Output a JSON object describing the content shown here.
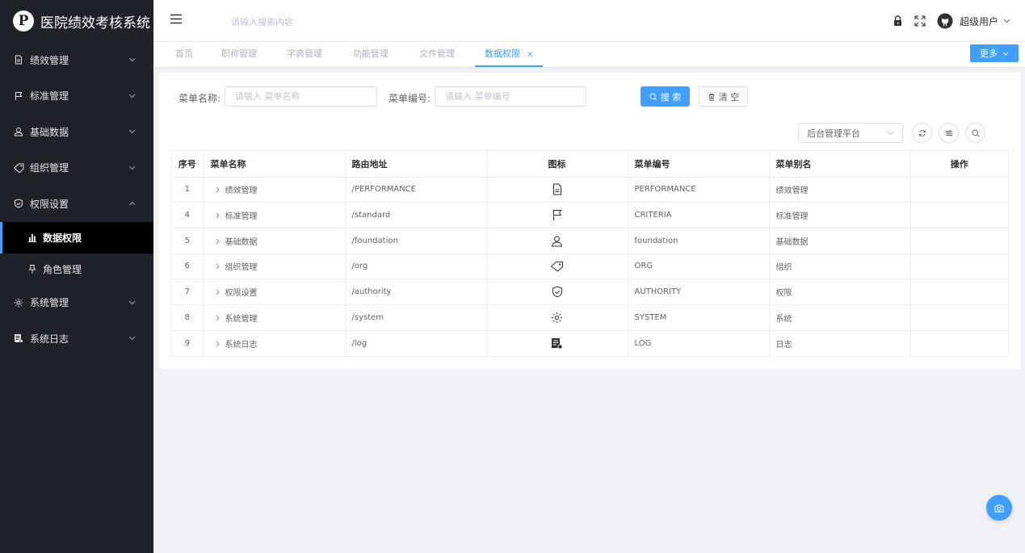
{
  "app": {
    "title": "医院绩效考核系统",
    "logo_letter": "P"
  },
  "sidebar": {
    "items": [
      {
        "label": "绩效管理",
        "icon": "document-icon",
        "expanded": false
      },
      {
        "label": "标准管理",
        "icon": "flag-icon",
        "expanded": false
      },
      {
        "label": "基础数据",
        "icon": "user-icon",
        "expanded": false
      },
      {
        "label": "组织管理",
        "icon": "tag-icon",
        "expanded": false
      },
      {
        "label": "权限设置",
        "icon": "shield-check-icon",
        "expanded": true,
        "children": [
          {
            "label": "数据权限",
            "icon": "bar-chart-icon",
            "active": true
          },
          {
            "label": "角色管理",
            "icon": "pin-icon",
            "active": false
          }
        ]
      },
      {
        "label": "系统管理",
        "icon": "gear-icon",
        "expanded": false
      },
      {
        "label": "系统日志",
        "icon": "log-icon",
        "expanded": false
      }
    ]
  },
  "header": {
    "search_placeholder": "请输入搜索内容",
    "username": "超级用户"
  },
  "tabs": {
    "items": [
      {
        "label": "首页",
        "active": false
      },
      {
        "label": "职称管理",
        "active": false
      },
      {
        "label": "字典管理",
        "active": false
      },
      {
        "label": "功能管理",
        "active": false
      },
      {
        "label": "文件管理",
        "active": false
      },
      {
        "label": "数据权限",
        "active": true,
        "close": "×"
      }
    ],
    "more_label": "更多"
  },
  "filters": {
    "menu_name_label": "菜单名称:",
    "menu_name_placeholder": "请输入 菜单名称",
    "menu_code_label": "菜单编号:",
    "menu_code_placeholder": "请输入 菜单编号",
    "search_label": "搜 索",
    "clear_label": "清 空",
    "platform_selected": "后台管理平台"
  },
  "table": {
    "columns": [
      "序号",
      "菜单名称",
      "路由地址",
      "图标",
      "菜单编号",
      "菜单别名",
      "操作"
    ],
    "rows": [
      {
        "index": "1",
        "name": "绩效管理",
        "route": "/PERFORMANCE",
        "icon": "document-icon",
        "code": "PERFORMANCE",
        "alias": "绩效管理",
        "action": ""
      },
      {
        "index": "4",
        "name": "标准管理",
        "route": "/standard",
        "icon": "flag-icon",
        "code": "CRITERIA",
        "alias": "标准管理",
        "action": ""
      },
      {
        "index": "5",
        "name": "基础数据",
        "route": "/foundation",
        "icon": "user-icon",
        "code": "foundation",
        "alias": "基础数据",
        "action": ""
      },
      {
        "index": "6",
        "name": "组织管理",
        "route": "/org",
        "icon": "tag-icon",
        "code": "ORG",
        "alias": "组织",
        "action": ""
      },
      {
        "index": "7",
        "name": "权限设置",
        "route": "/authority",
        "icon": "shield-check-icon",
        "code": "AUTHORITY",
        "alias": "权限",
        "action": ""
      },
      {
        "index": "8",
        "name": "系统管理",
        "route": "/system",
        "icon": "gear-icon",
        "code": "SYSTEM",
        "alias": "系统",
        "action": ""
      },
      {
        "index": "9",
        "name": "系统日志",
        "route": "/log",
        "icon": "log-icon",
        "code": "LOG",
        "alias": "日志",
        "action": ""
      }
    ]
  },
  "colors": {
    "sidebar_bg": "#20222a",
    "primary": "#409eff",
    "page_bg": "#f0f2f5"
  }
}
